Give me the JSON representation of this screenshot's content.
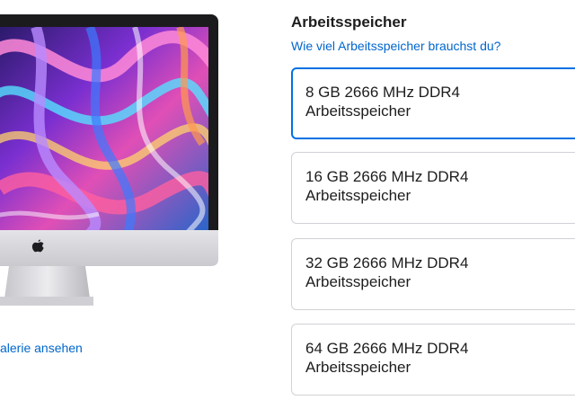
{
  "product": {
    "gallery_link": "alerie ansehen",
    "colors": {
      "apple_logo": "#1d1d1f",
      "aluminum": "#d9d9dd",
      "bezel": "#1b1b1d"
    }
  },
  "memory": {
    "title": "Arbeitsspeicher",
    "help_link": "Wie viel Arbeitsspeicher brauchst du?",
    "selected_index": 0,
    "accent_color": "#0071e3",
    "options": [
      {
        "line1": "8 GB 2666 MHz DDR4",
        "line2": "Arbeitsspeicher"
      },
      {
        "line1": "16 GB 2666 MHz DDR4",
        "line2": "Arbeitsspeicher"
      },
      {
        "line1": "32 GB 2666 MHz DDR4",
        "line2": "Arbeitsspeicher"
      },
      {
        "line1": "64 GB 2666 MHz DDR4",
        "line2": "Arbeitsspeicher"
      }
    ]
  }
}
